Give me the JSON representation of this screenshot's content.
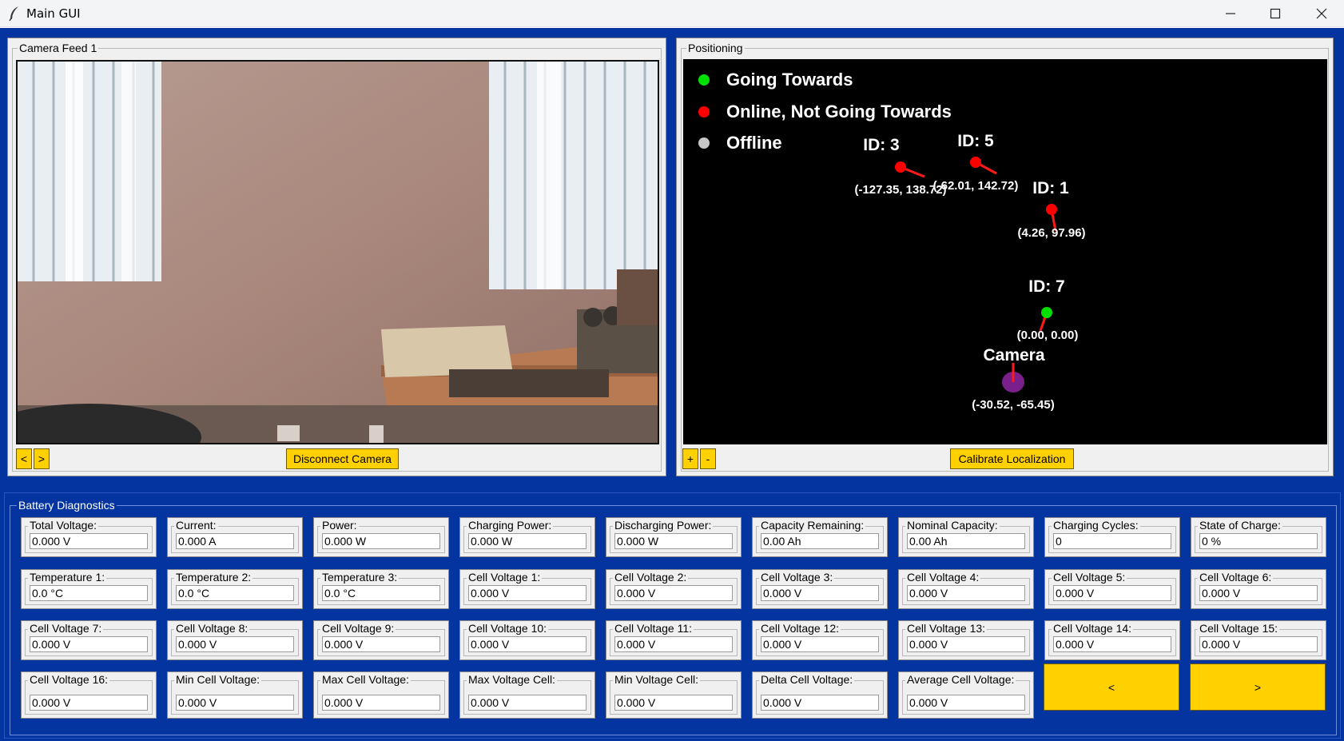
{
  "window": {
    "title": "Main GUI",
    "app_icon": "feather-icon",
    "controls": [
      "minimize-icon",
      "maximize-icon",
      "close-icon"
    ]
  },
  "colors": {
    "background_blue": "#0434a0",
    "button_yellow": "#ffd100",
    "going_towards": "#00e000",
    "online_not_going": "#ff0000",
    "offline": "#c8c8c8",
    "camera_marker": "#7a1f8c"
  },
  "camera_panel": {
    "title": "Camera Feed 1",
    "prev_label": "<",
    "next_label": ">",
    "disconnect_label": "Disconnect Camera"
  },
  "positioning_panel": {
    "title": "Positioning",
    "legend": [
      {
        "label": "Going Towards",
        "color": "#00e000"
      },
      {
        "label": "Online, Not Going Towards",
        "color": "#ff0000"
      },
      {
        "label": "Offline",
        "color": "#c8c8c8"
      }
    ],
    "markers": [
      {
        "id_label": "ID: 3",
        "coords": "(-127.35, 138.72)",
        "status": "online_not_going"
      },
      {
        "id_label": "ID: 5",
        "coords": "(-62.01, 142.72)",
        "status": "online_not_going"
      },
      {
        "id_label": "ID: 1",
        "coords": "(4.26, 97.96)",
        "status": "online_not_going"
      },
      {
        "id_label": "ID: 7",
        "coords": "(0.00, 0.00)",
        "status": "going_towards"
      },
      {
        "id_label": "Camera",
        "coords": "(-30.52, -65.45)",
        "status": "camera"
      }
    ],
    "zoom_in_label": "+",
    "zoom_out_label": "-",
    "calibrate_label": "Calibrate Localization"
  },
  "battery": {
    "title": "Battery Diagnostics",
    "fields": [
      {
        "label": "Total Voltage:",
        "value": "0.000 V"
      },
      {
        "label": "Current:",
        "value": "0.000 A"
      },
      {
        "label": "Power:",
        "value": "0.000 W"
      },
      {
        "label": "Charging Power:",
        "value": "0.000 W"
      },
      {
        "label": "Discharging Power:",
        "value": "0.000 W"
      },
      {
        "label": "Capacity Remaining:",
        "value": "0.00 Ah"
      },
      {
        "label": "Nominal Capacity:",
        "value": "0.00 Ah"
      },
      {
        "label": "Charging Cycles:",
        "value": "0"
      },
      {
        "label": "State of Charge:",
        "value": "0 %"
      },
      {
        "label": "Temperature 1:",
        "value": "0.0 °C"
      },
      {
        "label": "Temperature 2:",
        "value": "0.0 °C"
      },
      {
        "label": "Temperature 3:",
        "value": "0.0 °C"
      },
      {
        "label": "Cell Voltage 1:",
        "value": "0.000 V"
      },
      {
        "label": "Cell Voltage 2:",
        "value": "0.000 V"
      },
      {
        "label": "Cell Voltage 3:",
        "value": "0.000 V"
      },
      {
        "label": "Cell Voltage 4:",
        "value": "0.000 V"
      },
      {
        "label": "Cell Voltage 5:",
        "value": "0.000 V"
      },
      {
        "label": "Cell Voltage 6:",
        "value": "0.000 V"
      },
      {
        "label": "Cell Voltage 7:",
        "value": "0.000 V"
      },
      {
        "label": "Cell Voltage 8:",
        "value": "0.000 V"
      },
      {
        "label": "Cell Voltage 9:",
        "value": "0.000 V"
      },
      {
        "label": "Cell Voltage 10:",
        "value": "0.000 V"
      },
      {
        "label": "Cell Voltage 11:",
        "value": "0.000 V"
      },
      {
        "label": "Cell Voltage 12:",
        "value": "0.000 V"
      },
      {
        "label": "Cell Voltage 13:",
        "value": "0.000 V"
      },
      {
        "label": "Cell Voltage 14:",
        "value": "0.000 V"
      },
      {
        "label": "Cell Voltage 15:",
        "value": "0.000 V"
      },
      {
        "label": "Cell Voltage 16:",
        "value": "0.000 V"
      },
      {
        "label": "Min Cell Voltage:",
        "value": "0.000 V"
      },
      {
        "label": "Max Cell Voltage:",
        "value": "0.000 V"
      },
      {
        "label": "Max Voltage Cell:",
        "value": "0.000 V"
      },
      {
        "label": "Min Voltage Cell:",
        "value": "0.000 V"
      },
      {
        "label": "Delta Cell Voltage:",
        "value": "0.000 V"
      },
      {
        "label": "Average Cell Voltage:",
        "value": "0.000 V"
      }
    ],
    "prev_label": "<",
    "next_label": ">"
  }
}
